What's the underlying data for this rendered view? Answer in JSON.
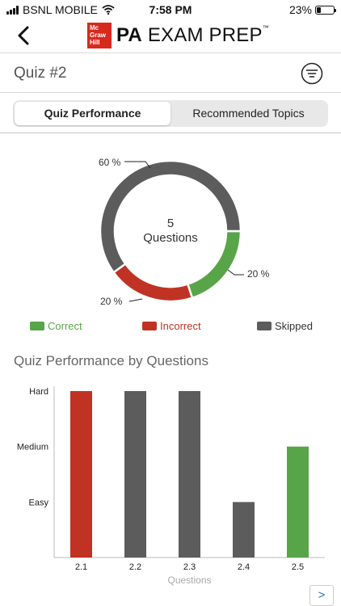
{
  "status_bar": {
    "carrier": "BSNL MOBILE",
    "time": "7:58 PM",
    "battery_text": "23%",
    "battery_level": 0.23
  },
  "header": {
    "logo_lines": [
      "Mc",
      "Graw",
      "Hill"
    ],
    "title_bold": "PA",
    "title_rest": "EXAM PREP",
    "trademark": "™"
  },
  "quiz": {
    "title": "Quiz #2"
  },
  "tabs": [
    {
      "label": "Quiz Performance",
      "active": true
    },
    {
      "label": "Recommended Topics",
      "active": false
    }
  ],
  "colors": {
    "correct": "#58a549",
    "incorrect": "#c03324",
    "skipped": "#5c5c5c",
    "brand": "#d8291d"
  },
  "donut": {
    "center_number": "5",
    "center_text": "Questions",
    "segments": [
      {
        "name": "Correct",
        "value": 20,
        "label": "20 %"
      },
      {
        "name": "Incorrect",
        "value": 20,
        "label": "20 %"
      },
      {
        "name": "Skipped",
        "value": 60,
        "label": "60 %"
      }
    ]
  },
  "legend": [
    "Correct",
    "Incorrect",
    "Skipped"
  ],
  "chart_data": {
    "type": "bar",
    "title": "Quiz Performance by Questions",
    "xlabel": "Questions",
    "ylabel": "",
    "categories": [
      "2.1",
      "2.2",
      "2.3",
      "2.4",
      "2.5"
    ],
    "y_levels": [
      "Easy",
      "Medium",
      "Hard"
    ],
    "values": [
      3,
      3,
      3,
      1,
      2
    ],
    "status": [
      "Incorrect",
      "Skipped",
      "Skipped",
      "Skipped",
      "Correct"
    ]
  },
  "pager": {
    "next_label": ">"
  }
}
